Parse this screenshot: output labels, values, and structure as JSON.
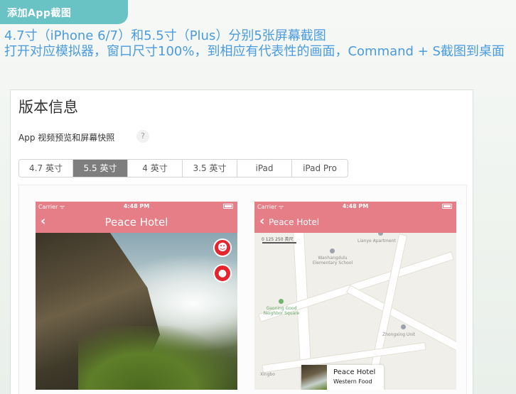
{
  "tag": {
    "label": "添加App截图"
  },
  "headline": {
    "line1": "4.7寸（iPhone 6/7）和5.5寸（Plus）分别5张屏幕截图",
    "line2": "打开对应模拟器，窗口尺寸100%，到相应有代表性的画面，Command + S截图到桌面"
  },
  "card": {
    "title": "版本信息",
    "section_label": "App 视频预览和屏幕快照",
    "help": "?"
  },
  "tabs": [
    {
      "label": "4.7 英寸",
      "active": false
    },
    {
      "label": "5.5 英寸",
      "active": true
    },
    {
      "label": "4 英寸",
      "active": false
    },
    {
      "label": "3.5 英寸",
      "active": false
    },
    {
      "label": "iPad",
      "active": false
    },
    {
      "label": "iPad Pro",
      "active": false
    }
  ],
  "screenshots": {
    "left": {
      "carrier": "Carrier ᯤ",
      "time": "4:48 PM",
      "back": "‹",
      "title": "Peace Hotel",
      "smile_icon": "☻",
      "pin_icon": "●"
    },
    "right": {
      "carrier": "Carrier ᯤ",
      "time": "4:48 PM",
      "back": "‹",
      "title": "Peace Hotel",
      "scale_labels": "0        125       250 英尺",
      "map_labels": {
        "lianye": "Lianye Apartment",
        "school": "Wanhangdulu Elementary School",
        "square": "Gaoning Good Neighbor Square",
        "unit": "Zhongxing Unit",
        "bottom": "Xingbo"
      },
      "callout": {
        "title": "Peace Hotel",
        "subtitle": "Western Food"
      }
    }
  },
  "colors": {
    "tag": "#69c3c4",
    "headline": "#4a9be0",
    "navbar": "#e57e86",
    "active_tab": "#7e7e7e"
  }
}
